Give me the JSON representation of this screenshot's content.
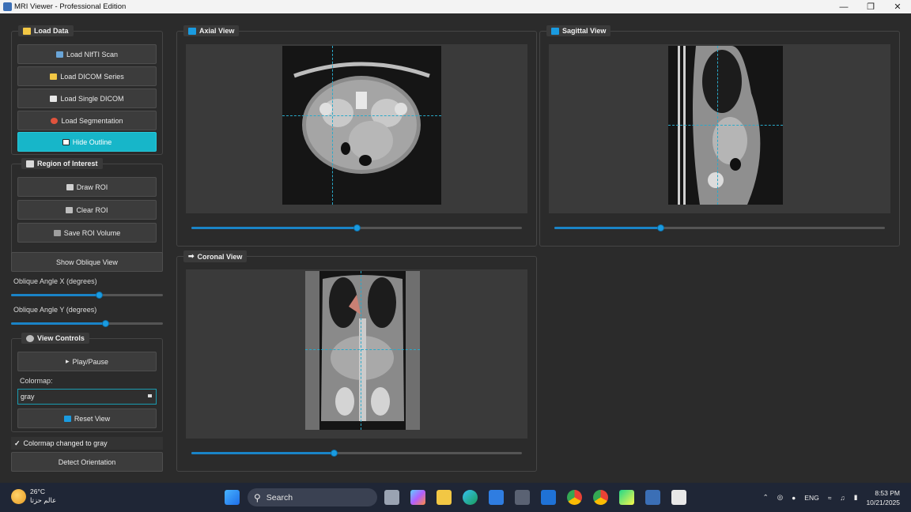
{
  "window": {
    "title": "MRI Viewer - Professional Edition"
  },
  "load_data": {
    "title": "Load Data",
    "buttons": [
      "Load NIfTI Scan",
      "Load DICOM Series",
      "Load Single DICOM",
      "Load Segmentation",
      "Hide Outline"
    ]
  },
  "roi": {
    "title": "Region of Interest",
    "buttons": [
      "Draw ROI",
      "Clear ROI",
      "Save ROI Volume"
    ]
  },
  "oblique": {
    "button": "Show Oblique View",
    "angle_x_label": "Oblique Angle X (degrees)",
    "angle_x_value": 0.58,
    "angle_y_label": "Oblique Angle Y (degrees)",
    "angle_y_value": 0.62
  },
  "view_controls": {
    "title": "View Controls",
    "play_button": "Play/Pause",
    "colormap_label": "Colormap:",
    "colormap_value": "gray",
    "reset_button": "Reset View"
  },
  "status": {
    "text": "Colormap changed to gray"
  },
  "detect_button": "Detect Orientation",
  "views": {
    "axial": {
      "title": "Axial View",
      "slice": 0.5
    },
    "sagittal": {
      "title": "Sagittal View",
      "slice": 0.32
    },
    "coronal": {
      "title": "Coronal View",
      "slice": 0.43
    }
  },
  "taskbar": {
    "weather_temp": "26°C",
    "weather_desc": "عالم حزتا",
    "search_placeholder": "Search",
    "language": "ENG",
    "time": "8:53 PM",
    "date": "10/21/2025"
  },
  "colors": {
    "accent": "#17b6c9",
    "slider": "#1a84c7",
    "background": "#2b2b2b"
  }
}
